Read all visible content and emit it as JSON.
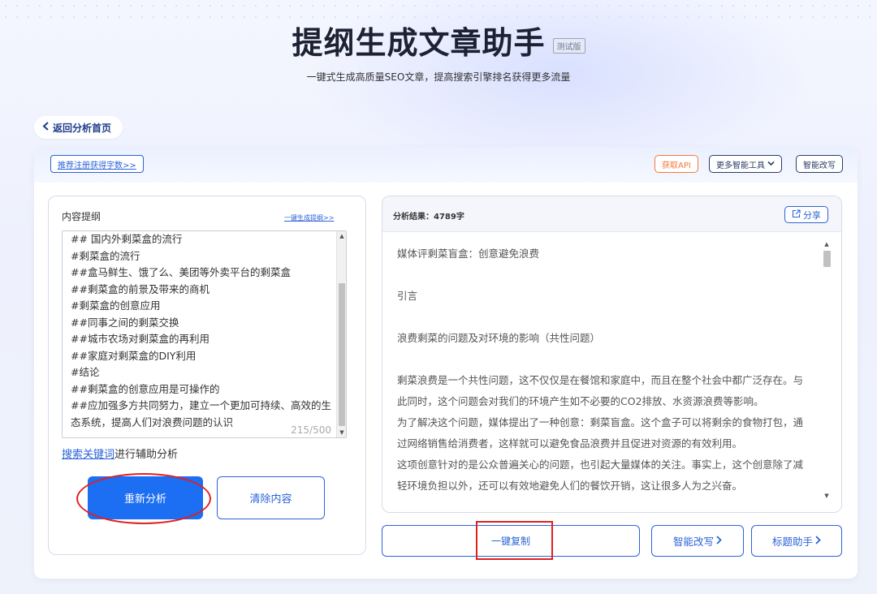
{
  "header": {
    "title": "提纲生成文章助手",
    "badge": "测试版",
    "subtitle": "一键式生成高质量SEO文章，提高搜索引擎排名获得更多流量"
  },
  "nav": {
    "back_label": "返回分析首页"
  },
  "toolbar": {
    "register_link": "推荐注册获得字数>>",
    "get_api": "获取API",
    "more_tools": "更多智能工具",
    "smart_rewrite": "智能改写"
  },
  "outline_panel": {
    "title": "内容提纲",
    "generate_link": "一键生成提纲>>",
    "content": "## 国内外剩菜盒的流行\n#剩菜盒的流行\n##盒马鲜生、饿了么、美团等外卖平台的剩菜盒\n##剩菜盒的前景及带来的商机\n#剩菜盒的创意应用\n##同事之间的剩菜交换\n##城市农场对剩菜盒的再利用\n##家庭对剩菜盒的DIY利用\n#结论\n##剩菜盒的创意应用是可操作的\n##应加强多方共同努力，建立一个更加可持续、高效的生态系统，提高人们对浪费问题的认识",
    "char_count": "215/500",
    "keyword_link": "搜索关键词",
    "keyword_suffix": "进行辅助分析",
    "reanalyze_label": "重新分析",
    "clear_label": "清除内容"
  },
  "result_panel": {
    "title": "分析结果：4789字",
    "share_label": "分享",
    "paragraphs": [
      "媒体评剩菜盲盒：创意避免浪费",
      "",
      "引言",
      "",
      "浪费剩菜的问题及对环境的影响（共性问题）",
      "",
      "剩菜浪费是一个共性问题，这不仅仅是在餐馆和家庭中，而且在整个社会中都广泛存在。与此同时，这个问题会对我们的环境产生如不必要的CO2排放、水资源浪费等影响。",
      "为了解决这个问题，媒体提出了一种创意：剩菜盲盒。这个盒子可以将剩余的食物打包，通过网络销售给消费者，这样就可以避免食品浪费并且促进对资源的有效利用。",
      "这项创意针对的是公众普遍关心的问题，也引起大量媒体的关注。事实上，这个创意除了减轻环境负担以外，还可以有效地避免人们的餐饮开销，这让很多人为之兴奋。"
    ]
  },
  "actions": {
    "copy_label": "一键复制",
    "smart_rewrite_label": "智能改写",
    "title_helper_label": "标题助手"
  }
}
